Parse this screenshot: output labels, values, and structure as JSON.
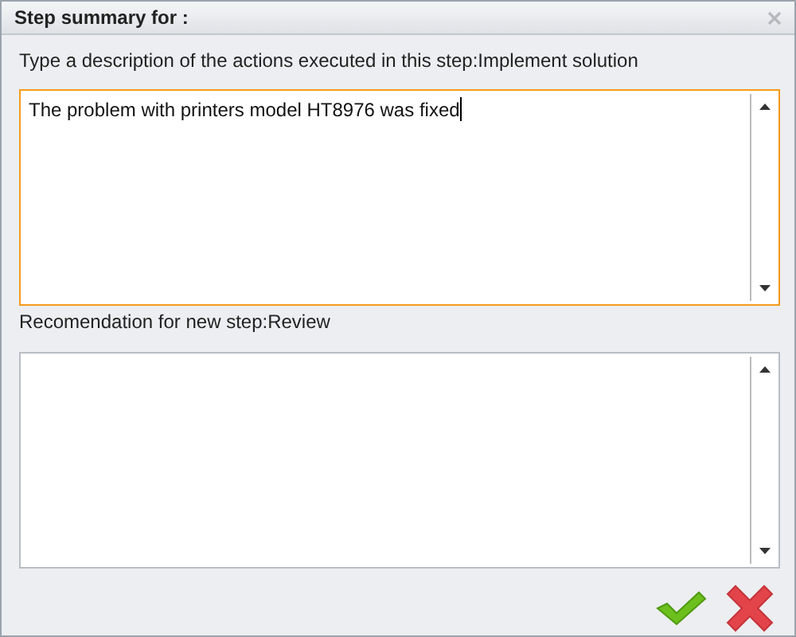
{
  "window": {
    "title": "Step summary for :"
  },
  "fields": [
    {
      "label": "Type a description of the actions executed in this step:Implement solution",
      "value": "The problem with printers model HT8976 was fixed",
      "focused": true
    },
    {
      "label": "Recomendation for new step:Review",
      "focused": false
    }
  ]
}
